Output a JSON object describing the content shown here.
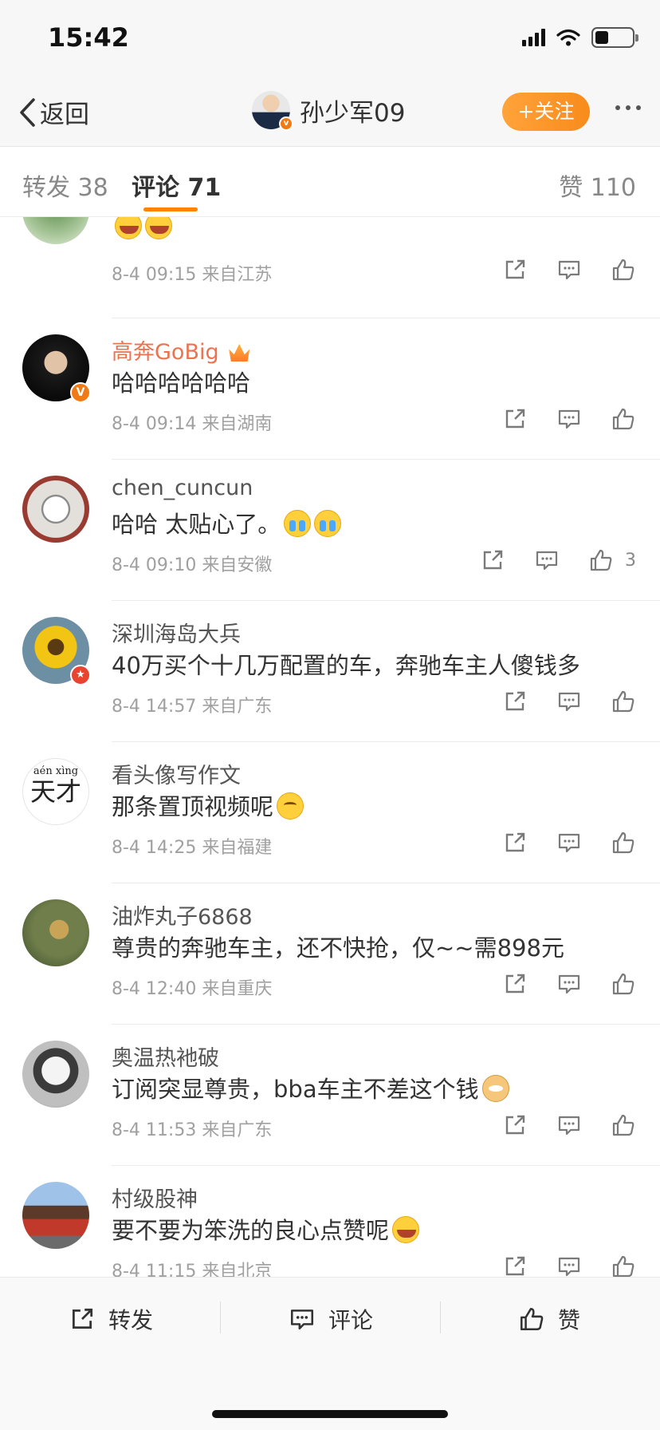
{
  "status_bar": {
    "time": "15:42"
  },
  "nav": {
    "back_label": "返回",
    "title": "孙少军09",
    "follow_label": "+关注"
  },
  "tabs": [
    {
      "label": "转发 38"
    },
    {
      "label": "评论 71"
    },
    {
      "label": "赞 110"
    }
  ],
  "comments": [
    {
      "author": "",
      "text": "",
      "emojis": [
        "laugh",
        "laugh"
      ],
      "date": "8-4 09:15",
      "source": "来自江苏",
      "likes": ""
    },
    {
      "author": "高奔GoBig",
      "text": "哈哈哈哈哈哈",
      "date": "8-4 09:14",
      "source": "来自湖南",
      "likes": ""
    },
    {
      "author": "chen_cuncun",
      "text": "哈哈 太贴心了。",
      "emojis": [
        "cry",
        "cry"
      ],
      "date": "8-4 09:10",
      "source": "来自安徽",
      "likes": "3"
    },
    {
      "author": "深圳海岛大兵",
      "text": "40万买个十几万配置的车，奔驰车主人傻钱多",
      "date": "8-4 14:57",
      "source": "来自广东",
      "likes": ""
    },
    {
      "author": "看头像写作文",
      "text": "那条置顶视频呢",
      "emojis": [
        "sad"
      ],
      "date": "8-4 14:25",
      "source": "来自福建",
      "likes": "",
      "avatar_text": {
        "pinyin": "aén xìng",
        "chars": "天才"
      }
    },
    {
      "author": "油炸丸子6868",
      "text": "尊贵的奔驰车主，还不快抢，仅~~需898元",
      "date": "8-4 12:40",
      "source": "来自重庆",
      "likes": ""
    },
    {
      "author": "奥温热衪破",
      "text": "订阅突显尊贵，bba车主不差这个钱",
      "emojis": [
        "doge"
      ],
      "date": "8-4 11:53",
      "source": "来自广东",
      "likes": ""
    },
    {
      "author": "村级股神",
      "text": "要不要为笨洗的良心点赞呢",
      "emojis": [
        "laugh"
      ],
      "date": "8-4 11:15",
      "source": "来自北京",
      "likes": ""
    }
  ],
  "bottom_bar": {
    "repost_label": "转发",
    "comment_label": "评论",
    "like_label": "赞"
  },
  "colors": {
    "accent": "#ff8200",
    "vip_name": "#eb7350",
    "follow_bg": "#f88b1b"
  }
}
